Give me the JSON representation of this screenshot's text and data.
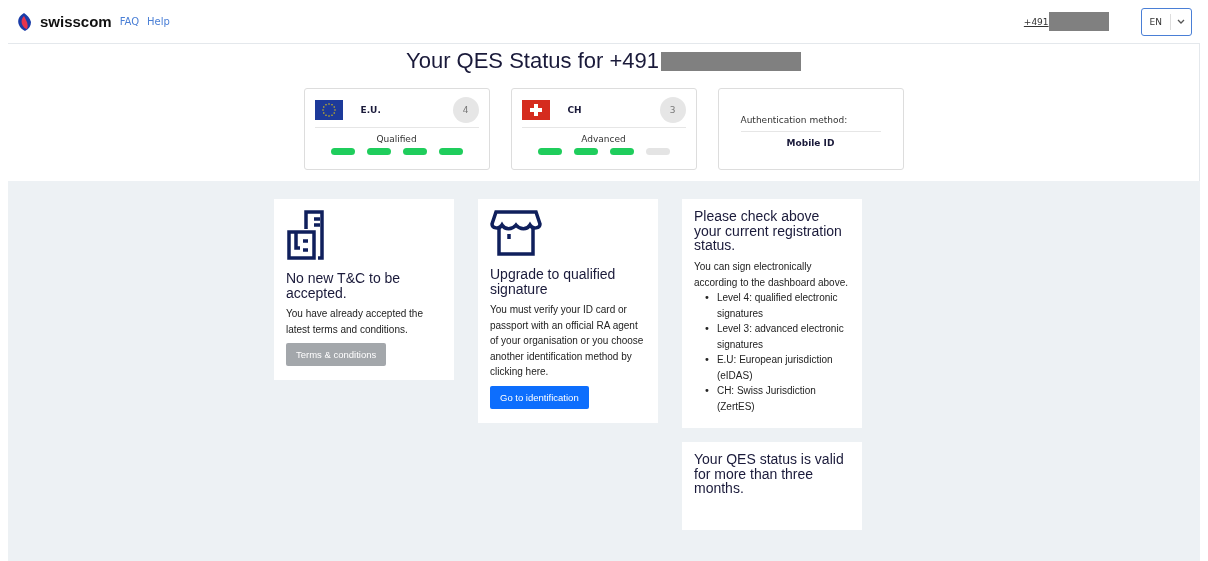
{
  "header": {
    "brand": "swisscom",
    "links": [
      "FAQ",
      "Help"
    ],
    "phone": "+491",
    "language": "EN"
  },
  "title": "Your QES Status for +491",
  "status_cards": [
    {
      "kind": "jurisdiction",
      "name": "E.U.",
      "count": "4",
      "level_label": "Qualified",
      "steps": [
        {
          "filled": true
        },
        {
          "filled": true
        },
        {
          "filled": true
        },
        {
          "filled": true
        }
      ]
    },
    {
      "kind": "jurisdiction",
      "name": "CH",
      "count": "3",
      "level_label": "Advanced",
      "steps": [
        {
          "filled": true
        },
        {
          "filled": true
        },
        {
          "filled": true
        },
        {
          "filled": false
        }
      ]
    },
    {
      "kind": "auth",
      "label": "Authentication method:",
      "value": "Mobile ID"
    }
  ],
  "info_cards": [
    {
      "kind": "action",
      "heading": "No new T&C to be accepted.",
      "text": "You have already accepted the latest terms and conditions.",
      "button": "Terms & conditions",
      "disabled": true
    },
    {
      "kind": "action",
      "heading": "Upgrade to qualified signature",
      "text": "You must verify your ID card or passport with an official RA agent of your organisation or you choose another identification method by clicking here.",
      "button": "Go to identification",
      "disabled": false
    },
    {
      "kind": "list",
      "heading": "Please check above your current registration status.",
      "text": "You can sign electronically according to the dashboard above.",
      "items": [
        {
          "bullet": "•",
          "text": "Level 4: qualified electronic signatures"
        },
        {
          "bullet": "•",
          "text": "Level 3: advanced electronic signatures"
        },
        {
          "bullet": "•",
          "text": "E.U: European jurisdiction (eIDAS)"
        },
        {
          "bullet": "•",
          "text": "CH: Swiss Jurisdiction (ZertES)"
        }
      ]
    },
    {
      "kind": "note",
      "heading": "Your QES status is valid for more than three months."
    }
  ]
}
